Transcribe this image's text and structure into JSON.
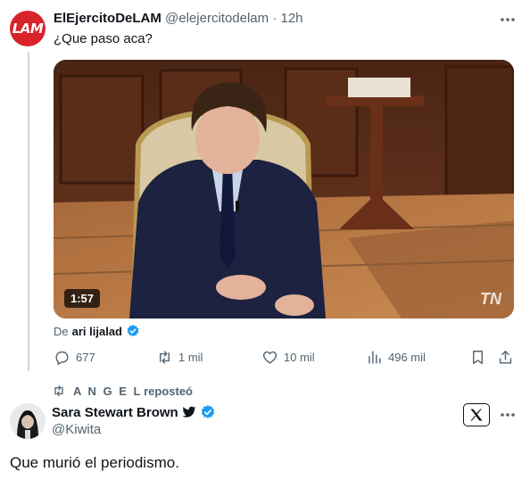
{
  "tweet1": {
    "avatar_text": "LAM",
    "display_name": "ElEjercitoDeLAM",
    "handle": "@elejercitodelam",
    "separator": "·",
    "time": "12h",
    "text": "¿Que paso aca?",
    "video": {
      "duration": "1:57",
      "channel_logo": "TN"
    },
    "from_prefix": "De",
    "from_author": "ari lijalad",
    "stats": {
      "replies": "677",
      "reposts": "1 mil",
      "likes": "10 mil",
      "views": "496 mil"
    }
  },
  "repost": {
    "reposter": "A N G E L",
    "label": "reposteó"
  },
  "tweet2": {
    "display_name": "Sara Stewart Brown",
    "handle": "@Kiwita",
    "text": "Que murió el periodismo."
  },
  "colors": {
    "text_primary": "#0f1419",
    "text_secondary": "#536471",
    "verified": "#1d9bf0",
    "thread_line": "#cfd9de",
    "lam_red": "#d8232a"
  },
  "icons": [
    "more-icon",
    "reply-icon",
    "repost-icon",
    "like-icon",
    "views-icon",
    "bookmark-icon",
    "share-icon",
    "verified-icon",
    "bird-icon",
    "x-logo-icon"
  ]
}
